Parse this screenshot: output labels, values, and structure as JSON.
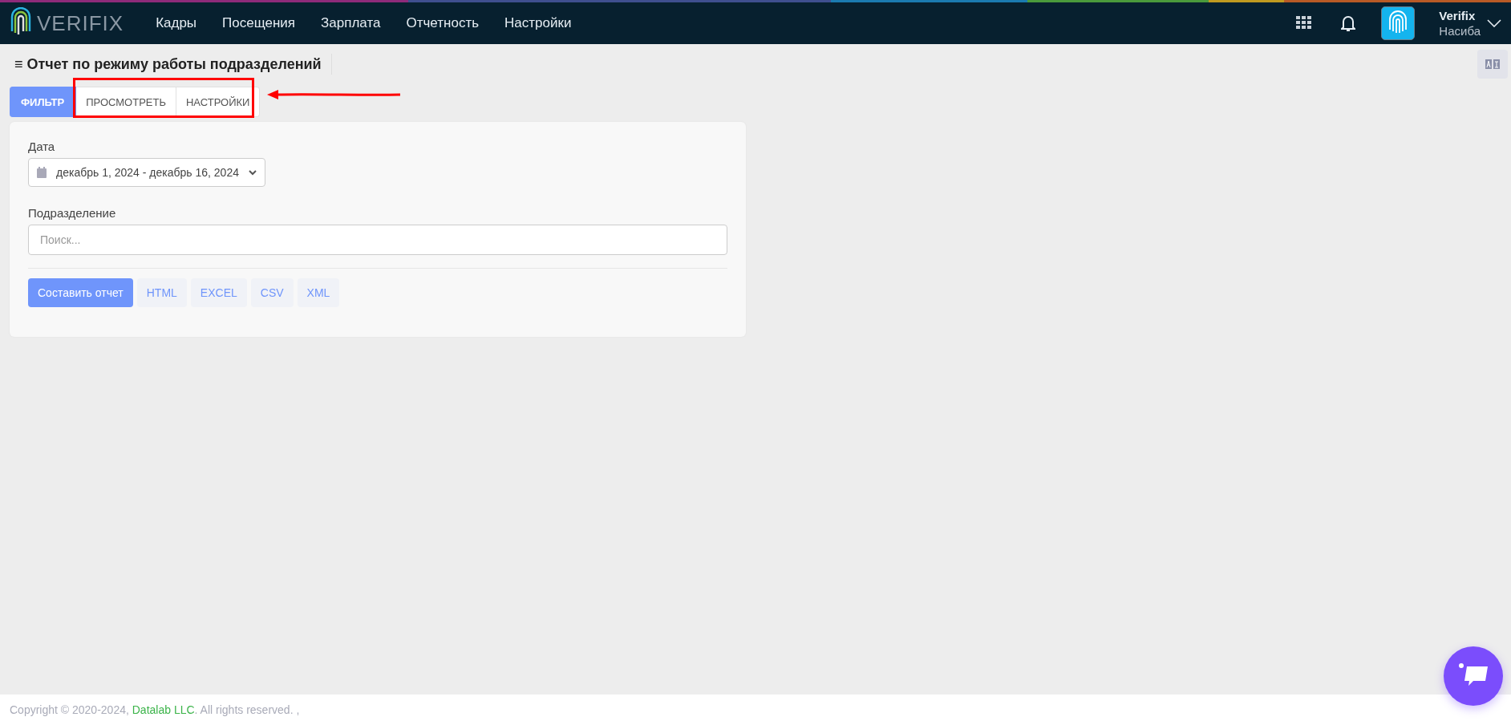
{
  "header": {
    "logo": "VERIFIX",
    "nav": [
      {
        "label": "Кадры"
      },
      {
        "label": "Посещения"
      },
      {
        "label": "Зарплата"
      },
      {
        "label": "Отчетность"
      },
      {
        "label": "Настройки"
      }
    ],
    "user": {
      "company": "Verifix",
      "name": "Насиба"
    }
  },
  "page": {
    "title": "Отчет по режиму работы подразделений",
    "menu_glyph": "≡"
  },
  "tabs": [
    {
      "label": "ФИЛЬТР",
      "selected": true
    },
    {
      "label": "ПРОСМОТРЕТЬ",
      "selected": false
    },
    {
      "label": "НАСТРОЙКИ",
      "selected": false
    }
  ],
  "filter": {
    "date_label": "Дата",
    "date_value": "декабрь 1, 2024 - декабрь 16, 2024",
    "division_label": "Подразделение",
    "division_placeholder": "Поиск...",
    "buttons": [
      {
        "label": "Составить отчет",
        "kind": "primary"
      },
      {
        "label": "HTML",
        "kind": "export"
      },
      {
        "label": "EXCEL",
        "kind": "export"
      },
      {
        "label": "CSV",
        "kind": "export"
      },
      {
        "label": "XML",
        "kind": "export"
      }
    ]
  },
  "footer": {
    "prefix": "Copyright © 2020-2024, ",
    "link": "Datalab LLC",
    "suffix": ". All rights reserved. ,"
  }
}
